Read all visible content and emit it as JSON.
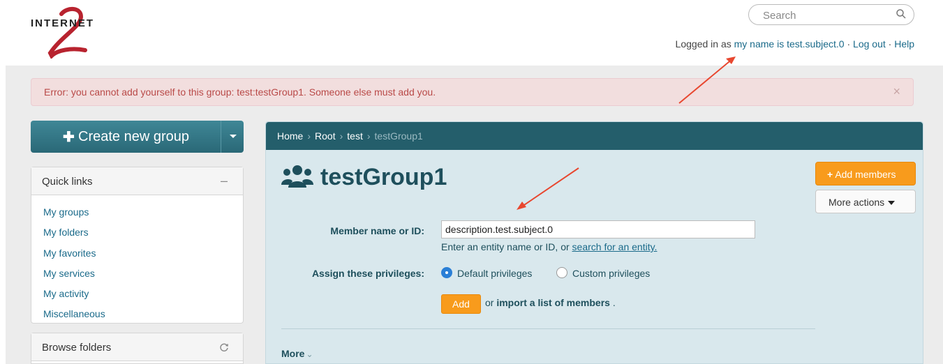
{
  "header": {
    "logo_text": "INTERNET",
    "search_placeholder": "Search",
    "logged_in_prefix": "Logged in as",
    "user_name": "my name is test.subject.0",
    "sep1": "·",
    "logout": "Log out",
    "sep2": "·",
    "help": "Help"
  },
  "error": {
    "message": "Error: you cannot add yourself to this group: test:testGroup1. Someone else must add you.",
    "close": "×"
  },
  "sidebar": {
    "create_button": "Create new group",
    "quick_links": {
      "title": "Quick links",
      "toggle": "–",
      "items": [
        "My groups",
        "My folders",
        "My favorites",
        "My services",
        "My activity",
        "Miscellaneous"
      ]
    },
    "browse_folders": {
      "title": "Browse folders"
    }
  },
  "breadcrumb": {
    "items": [
      "Home",
      "Root",
      "test"
    ],
    "current": "testGroup1",
    "separator": "›"
  },
  "group": {
    "title": "testGroup1",
    "add_members": "Add members",
    "more_actions": "More actions"
  },
  "form": {
    "member_label": "Member name or ID:",
    "member_value": "description.test.subject.0",
    "help_prefix": "Enter an entity name or ID, or",
    "help_link": "search for an entity.",
    "privileges_label": "Assign these privileges:",
    "default_privileges": "Default privileges",
    "custom_privileges": "Custom privileges",
    "add_button": "Add",
    "or_text": "or",
    "import_link": "import a list of members",
    "period": ".",
    "more": "More"
  },
  "colors": {
    "brand_teal": "#245e6b",
    "accent_orange": "#f89b1c",
    "error_bg": "#f2dede",
    "annotation_red": "#e8472f"
  }
}
